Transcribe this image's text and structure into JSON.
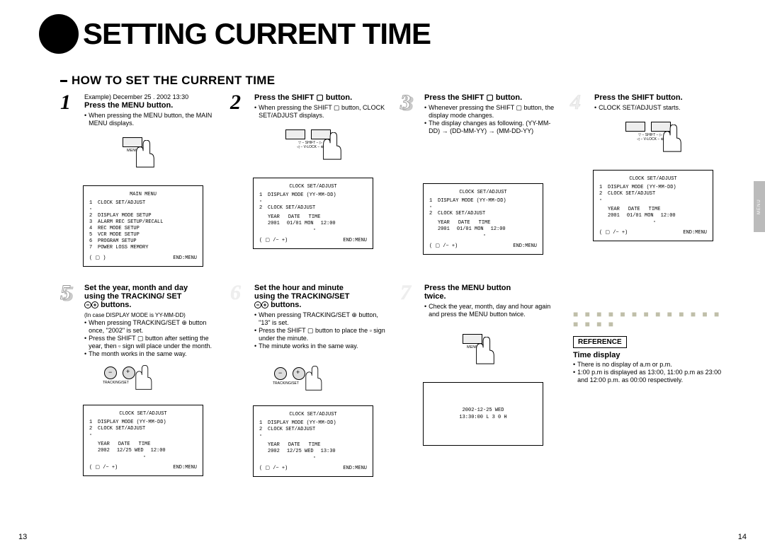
{
  "title": "SETTING CURRENT TIME",
  "section_title": "HOW TO SET THE CURRENT TIME",
  "side_tab": "MENU",
  "page_left": "13",
  "page_right": "14",
  "steps": {
    "s1": {
      "num": "1",
      "example": "Example) December 25 . 2002 13:30",
      "title": "Press the MENU button.",
      "bul1": "When pressing the MENU button, the MAIN MENU displays.",
      "btn_label": "MENU",
      "screen": {
        "hd": "MAIN MENU",
        "r1": "CLOCK SET/ADJUST",
        "r2": "DISPLAY MODE SETUP",
        "r3": "ALARM REC SETUP/RECALL",
        "r4": "REC MODE SETUP",
        "r5": "VCR MODE SETUP",
        "r6": "PROGRAM SETUP",
        "r7": "POWER LOSS MEMORY",
        "foot_l": "(   ▢   )",
        "foot_r": "END:MENU"
      }
    },
    "s2": {
      "num": "2",
      "title": "Press the SHIFT ▢  button.",
      "bul1": "When pressing the SHIFT ▢  button, CLOCK SET/ADJUST displays.",
      "ctrl_top": "▽ − SHIFT − ▷",
      "ctrl_bot": "◁ − V-LOCK − ⊕",
      "screen": {
        "hd": "CLOCK SET/ADJUST",
        "r1": "DISPLAY MODE (YY-MM-DD)",
        "r2": "CLOCK SET/ADJUST",
        "h_year": "YEAR",
        "h_date": "DATE",
        "h_time": "TIME",
        "v_year": "2001",
        "v_date": "01/01 MON",
        "v_time": "12:00",
        "cursor": "▫",
        "foot_l": "( ▢ /− +)",
        "foot_r": "END:MENU"
      }
    },
    "s3": {
      "num": "3",
      "title": "Press the SHIFT ▢  button.",
      "bul1": "Whenever pressing the SHIFT ▢ button, the display mode changes.",
      "bul2": "The display changes as following. (YY-MM-DD) → (DD-MM-YY) → (MM-DD-YY)",
      "screen": {
        "hd": "CLOCK SET/ADJUST",
        "r1": "DISPLAY MODE (YY-MM-DD)",
        "r2": "CLOCK SET/ADJUST",
        "h_year": "YEAR",
        "h_date": "DATE",
        "h_time": "TIME",
        "v_year": "2001",
        "v_date": "01/01 MON",
        "v_time": "12:00",
        "cursor": "▫",
        "foot_l": "( ▢ /− +)",
        "foot_r": "END:MENU"
      }
    },
    "s4": {
      "num": "4",
      "title": "Press the SHIFT      button.",
      "bul1": "CLOCK SET/ADJUST starts.",
      "ctrl_top": "▽ − SHIFT − ▷",
      "ctrl_bot": "◁ − V-LOCK − ⊕",
      "screen": {
        "hd": "CLOCK SET/ADJUST",
        "r1": "DISPLAY MODE (YY-MM-DD)",
        "r2": "CLOCK SET/ADJUST",
        "h_year": "YEAR",
        "h_date": "DATE",
        "h_time": "TIME",
        "v_year": "2001",
        "v_date": "01/01 MON",
        "v_time": "12:00",
        "cursor": "▫",
        "foot_l": "( ▢ /− +)",
        "foot_r": "END:MENU"
      }
    },
    "s5": {
      "num": "5",
      "title1": "Set the year, month and day",
      "title2": "using the TRACKING/ SET",
      "title3": "⊖⊕ buttons.",
      "note": "(In case DISPLAY MODE is YY-MM-DD)",
      "bul1": "When pressing TRACKING/SET ⊕ button once, \"2002\" is set.",
      "bul2": "Press the SHIFT ▢ button after setting the year, then ▫ sign will place under the month.",
      "bul3": "The month works in the same way.",
      "track_label": "TRACKING/SET",
      "screen": {
        "hd": "CLOCK SET/ADJUST",
        "r1": "DISPLAY MODE (YY-MM-DD)",
        "r2": "CLOCK SET/ADJUST",
        "h_year": "YEAR",
        "h_date": "DATE",
        "h_time": "TIME",
        "v_year": "2002",
        "v_date": "12/25 WED",
        "v_time": "12:00",
        "cursor": "▫",
        "foot_l": "( ▢ /− +)",
        "foot_r": "END:MENU"
      }
    },
    "s6": {
      "num": "6",
      "title1": "Set the hour and minute",
      "title2": "using the TRACKING/SET",
      "title3": "⊖⊕ buttons.",
      "bul1": "When pressing TRACKING/SET ⊕ button, \"13\" is set.",
      "bul2": "Press the SHIFT ▢ button to place the ▫ sign under the minute.",
      "bul3": "The minute works in the same way.",
      "track_label": "TRACKING/SET",
      "screen": {
        "hd": "CLOCK SET/ADJUST",
        "r1": "DISPLAY MODE (YY-MM-DD)",
        "r2": "CLOCK SET/ADJUST",
        "h_year": "YEAR",
        "h_date": "DATE",
        "h_time": "TIME",
        "v_year": "2002",
        "v_date": "12/25 WED",
        "v_time": "13:30",
        "cursor": "▫",
        "foot_l": "( ▢ /− +)",
        "foot_r": "END:MENU"
      }
    },
    "s7": {
      "num": "7",
      "title1": "Press the MENU button",
      "title2": "twice.",
      "bul1": "Check the year, month, day and hour again and press the MENU button twice.",
      "btn_label": "MENU",
      "final_l1": "2002-12-25 WED",
      "final_l2": "13:30:00  L 3 0 H"
    }
  },
  "reference": {
    "box": "REFERENCE",
    "title": "Time display",
    "bul1": "There is no display of a.m or p.m.",
    "bul2": "1:00 p.m is displayed as 13:00, 11:00 p.m as 23:00 and 12:00 p.m. as 00:00 respectively."
  }
}
